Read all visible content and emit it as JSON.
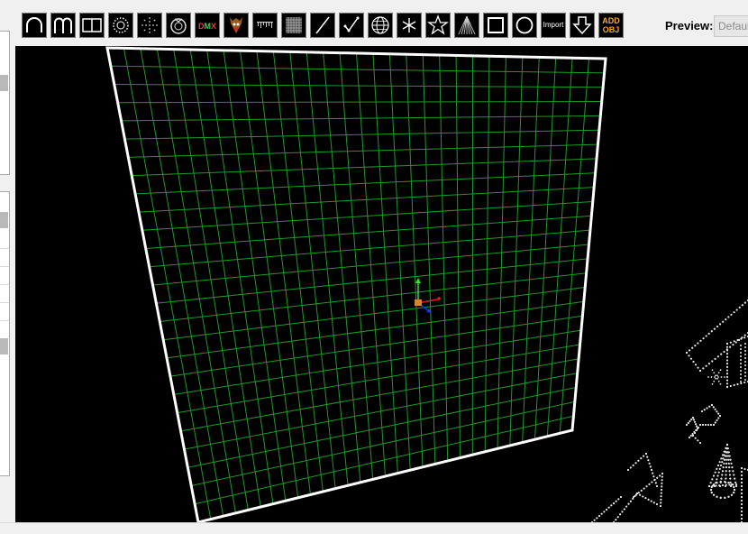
{
  "toolbar": {
    "tools": [
      {
        "name": "arch-tool",
        "icon": "arch-icon"
      },
      {
        "name": "candy-cane-tool",
        "icon": "candy-cane-icon"
      },
      {
        "name": "window-frame-tool",
        "icon": "window-frame-icon"
      },
      {
        "name": "circle-dots-tool",
        "icon": "circle-dots-icon"
      },
      {
        "name": "starburst-tool",
        "icon": "starburst-icon"
      },
      {
        "name": "wreath-tool",
        "icon": "wreath-icon"
      },
      {
        "name": "dmx-tool",
        "icon": "dmx-icon",
        "label": "DMX"
      },
      {
        "name": "image-tool",
        "icon": "image-icon"
      },
      {
        "name": "icicles-tool",
        "icon": "icicles-icon"
      },
      {
        "name": "matrix-tool",
        "icon": "matrix-icon"
      },
      {
        "name": "single-line-tool",
        "icon": "single-line-icon"
      },
      {
        "name": "poly-line-tool",
        "icon": "poly-line-icon"
      },
      {
        "name": "sphere-tool",
        "icon": "sphere-icon"
      },
      {
        "name": "spinner-tool",
        "icon": "spinner-icon"
      },
      {
        "name": "star-tool",
        "icon": "star-icon"
      },
      {
        "name": "tree-tool",
        "icon": "tree-icon"
      },
      {
        "name": "cube-tool",
        "icon": "cube-icon"
      },
      {
        "name": "circle-tool",
        "icon": "circle-icon"
      },
      {
        "name": "import-tool",
        "icon": "import-icon",
        "label": "Import"
      },
      {
        "name": "download-tool",
        "icon": "down-arrow-icon"
      },
      {
        "name": "add-object-tool",
        "icon": "add-object-icon",
        "label": "ADD OBJ"
      }
    ]
  },
  "preview": {
    "label": "Preview:",
    "selected": "Default"
  },
  "colors": {
    "grid": "#1f9a2a",
    "frame": "#ffffff",
    "background": "#000000",
    "add_accent": "#f5a623"
  }
}
